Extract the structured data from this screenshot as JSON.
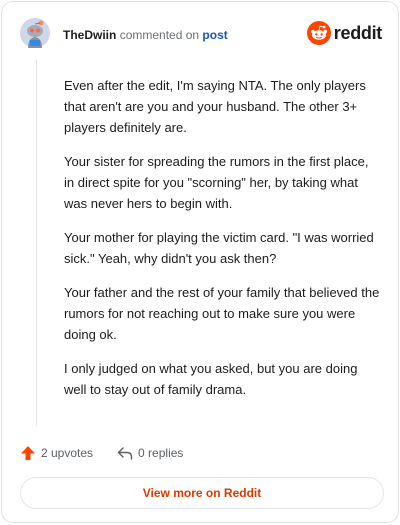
{
  "header": {
    "username": "TheDwiin",
    "action": "commented on",
    "link": "post",
    "brand": "reddit"
  },
  "comment": {
    "paragraphs": [
      "Even after the edit, I'm saying NTA. The only players that aren't are you and your husband. The other 3+ players definitely are.",
      "Your sister for spreading the rumors in the first place, in direct spite for you \"scorning\" her, by taking what was never hers to begin with.",
      "Your mother for playing the victim card. \"I was worried sick.\" Yeah, why didn't you ask then?",
      "Your father and the rest of your family that believed the rumors for not reaching out to make sure you were doing ok.",
      "I only judged on what you asked, but you are doing well to stay out of family drama."
    ]
  },
  "footer": {
    "upvotes": "2 upvotes",
    "replies": "0 replies",
    "view_more": "View more on Reddit"
  },
  "colors": {
    "accent": "#d93a00",
    "upvote": "#ff4500",
    "link": "#1a55b8"
  }
}
